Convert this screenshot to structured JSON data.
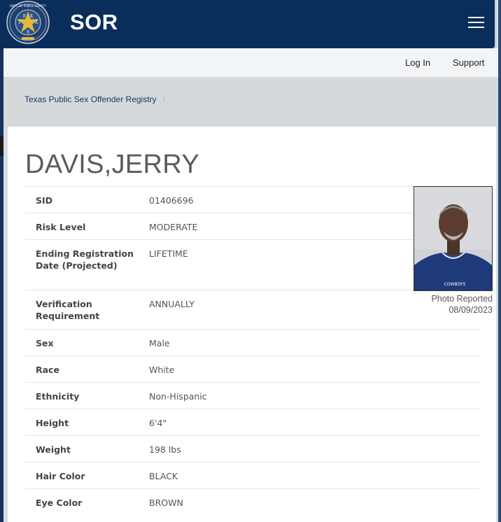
{
  "header": {
    "brand": "SOR",
    "seal_icon": "texas-dps-seal-icon",
    "seal_text": "DEPARTMENT OF PUBLIC SAFETY · TEXAS",
    "menu_icon": "hamburger-menu-icon",
    "colors": {
      "navy": "#0a2e5c",
      "gold": "#e2b93b"
    }
  },
  "nav": {
    "login": "Log In",
    "support": "Support"
  },
  "breadcrumb": {
    "item": "Texas Public Sex Offender Registry",
    "separator": "/"
  },
  "profile": {
    "name": "DAVIS,JERRY",
    "rows": [
      {
        "label": "SID",
        "value": "01406696"
      },
      {
        "label": "Risk Level",
        "value": "MODERATE"
      },
      {
        "label": "Ending Registration Date (Projected)",
        "value": "LIFETIME"
      },
      {
        "label": "Verification Requirement",
        "value": "ANNUALLY"
      },
      {
        "label": "Sex",
        "value": "Male"
      },
      {
        "label": "Race",
        "value": "White"
      },
      {
        "label": "Ethnicity",
        "value": "Non-Hispanic"
      },
      {
        "label": "Height",
        "value": "6'4\""
      },
      {
        "label": "Weight",
        "value": "198 lbs"
      },
      {
        "label": "Hair Color",
        "value": "BLACK"
      },
      {
        "label": "Eye Color",
        "value": "BROWN"
      }
    ],
    "photo": {
      "caption_line1": "Photo Reported",
      "caption_line2": "08/09/2023",
      "shirt_text": "COWBOYS"
    }
  }
}
